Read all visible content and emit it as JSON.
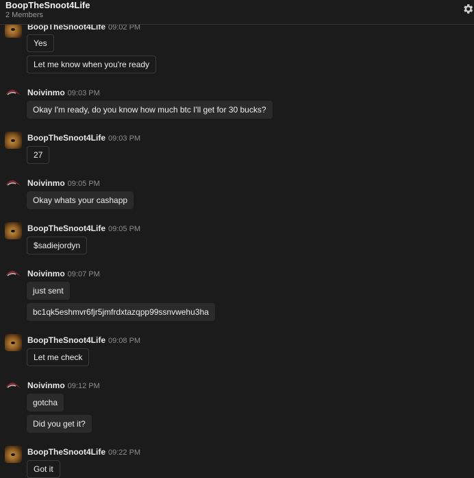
{
  "header": {
    "title": "BoopTheSnoot4Life",
    "members": "2 Members",
    "settings_icon": "gear-icon"
  },
  "users": {
    "a": "BoopTheSnoot4Life",
    "b": "Noivinmo"
  },
  "groups": [
    {
      "user": "BoopTheSnoot4Life",
      "time": "09:02 PM",
      "messages": [
        "Yes",
        "Let me know when you're ready"
      ]
    },
    {
      "user": "Noivinmo",
      "time": "09:03 PM",
      "messages": [
        "Okay I'm ready, do you know how much btc I'll get for 30 bucks?"
      ]
    },
    {
      "user": "BoopTheSnoot4Life",
      "time": "09:03 PM",
      "messages": [
        "27"
      ]
    },
    {
      "user": "Noivinmo",
      "time": "09:05 PM",
      "messages": [
        "Okay whats your cashapp"
      ]
    },
    {
      "user": "BoopTheSnoot4Life",
      "time": "09:05 PM",
      "messages": [
        "$sadiejordyn"
      ]
    },
    {
      "user": "Noivinmo",
      "time": "09:07 PM",
      "messages": [
        "just sent",
        "bc1qk5eshmvr6fjr5jmfrdxtazqpp99ssnvwehu3ha"
      ]
    },
    {
      "user": "BoopTheSnoot4Life",
      "time": "09:08 PM",
      "messages": [
        "Let me check"
      ]
    },
    {
      "user": "Noivinmo",
      "time": "09:12 PM",
      "messages": [
        "gotcha",
        "Did you get it?"
      ]
    },
    {
      "user": "BoopTheSnoot4Life",
      "time": "09:22 PM",
      "messages": [
        "Got it"
      ]
    }
  ]
}
